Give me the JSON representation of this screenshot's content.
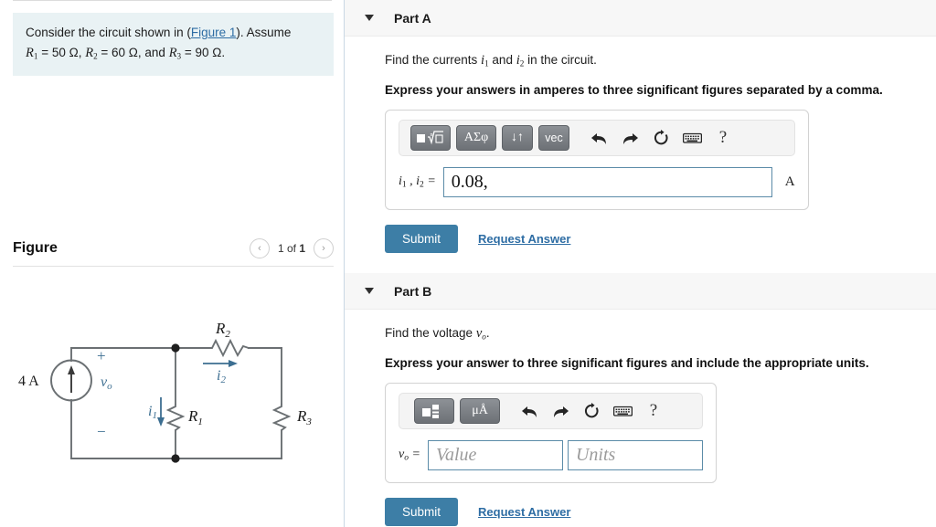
{
  "left": {
    "question": {
      "text_before_link": "Consider the circuit shown in (",
      "link_label": "Figure 1",
      "text_after_link": "). Assume",
      "line2_r1_sym": "R",
      "line2_r1_sub": "1",
      "line2_r1_val": " = 50 Ω, ",
      "line2_r2_sym": "R",
      "line2_r2_sub": "2",
      "line2_r2_val": " = 60 Ω, and ",
      "line2_r3_sym": "R",
      "line2_r3_sub": "3",
      "line2_r3_val": " = 90 Ω."
    },
    "figure": {
      "title": "Figure",
      "prev_glyph": "‹",
      "next_glyph": "›",
      "count_prefix": "1 of ",
      "count_total": "1"
    },
    "circuit": {
      "source_label": "4 A",
      "plus": "+",
      "minus": "−",
      "vo_sym": "v",
      "vo_sub": "o",
      "i1_sym": "i",
      "i1_sub": "1",
      "i2_sym": "i",
      "i2_sub": "2",
      "r1_sym": "R",
      "r1_sub": "1",
      "r2_sym": "R",
      "r2_sub": "2",
      "r3_sym": "R",
      "r3_sub": "3",
      "wire_color": "#6b7073",
      "annotation_color": "#3c6e91"
    }
  },
  "right": {
    "part_a": {
      "title": "Part A",
      "prompt_pre": "Find the currents ",
      "prompt_i1": "i",
      "prompt_i1_sub": "1",
      "prompt_mid": "  and ",
      "prompt_i2": "i",
      "prompt_i2_sub": "2",
      "prompt_post": "  in the circuit.",
      "instruction": "Express your answers in amperes to three significant figures separated by a comma.",
      "toolbar": {
        "template_label": "■√□",
        "greek_label": "ΑΣφ",
        "arrows_label": "↓↑",
        "vec_label": "vec",
        "undo_icon": "undo-icon",
        "redo_icon": "redo-icon",
        "reset_icon": "reset-icon",
        "keyboard_icon": "keyboard-icon",
        "help_label": "?"
      },
      "input_label_i1": "i",
      "input_label_i1_sub": "1",
      "input_label_comma": " , ",
      "input_label_i2": "i",
      "input_label_i2_sub": "2",
      "input_label_eq": " =",
      "input_value": "0.08,",
      "input_placeholder": "",
      "unit": "A",
      "submit_label": "Submit",
      "request_label": "Request Answer"
    },
    "part_b": {
      "title": "Part B",
      "prompt_pre": "Find the voltage ",
      "prompt_v": "v",
      "prompt_v_sub": "o",
      "prompt_post": ".",
      "instruction": "Express your answer to three significant figures and include the appropriate units.",
      "toolbar": {
        "template_label": "■□",
        "units_label": "μÅ",
        "undo_icon": "undo-icon",
        "redo_icon": "redo-icon",
        "reset_icon": "reset-icon",
        "keyboard_icon": "keyboard-icon",
        "help_label": "?"
      },
      "input_label_v": "v",
      "input_label_v_sub": "o",
      "input_label_eq": " =",
      "value_placeholder": "Value",
      "value_current": "",
      "units_placeholder": "Units",
      "units_current": "",
      "submit_label": "Submit",
      "request_label": "Request Answer"
    }
  },
  "colors": {
    "accent_blue": "#3d7ea6",
    "link_blue": "#2e6da4",
    "question_bg": "#e9f2f4",
    "part_bar_bg": "#f7f7f7",
    "input_border": "#5b8ba8"
  }
}
